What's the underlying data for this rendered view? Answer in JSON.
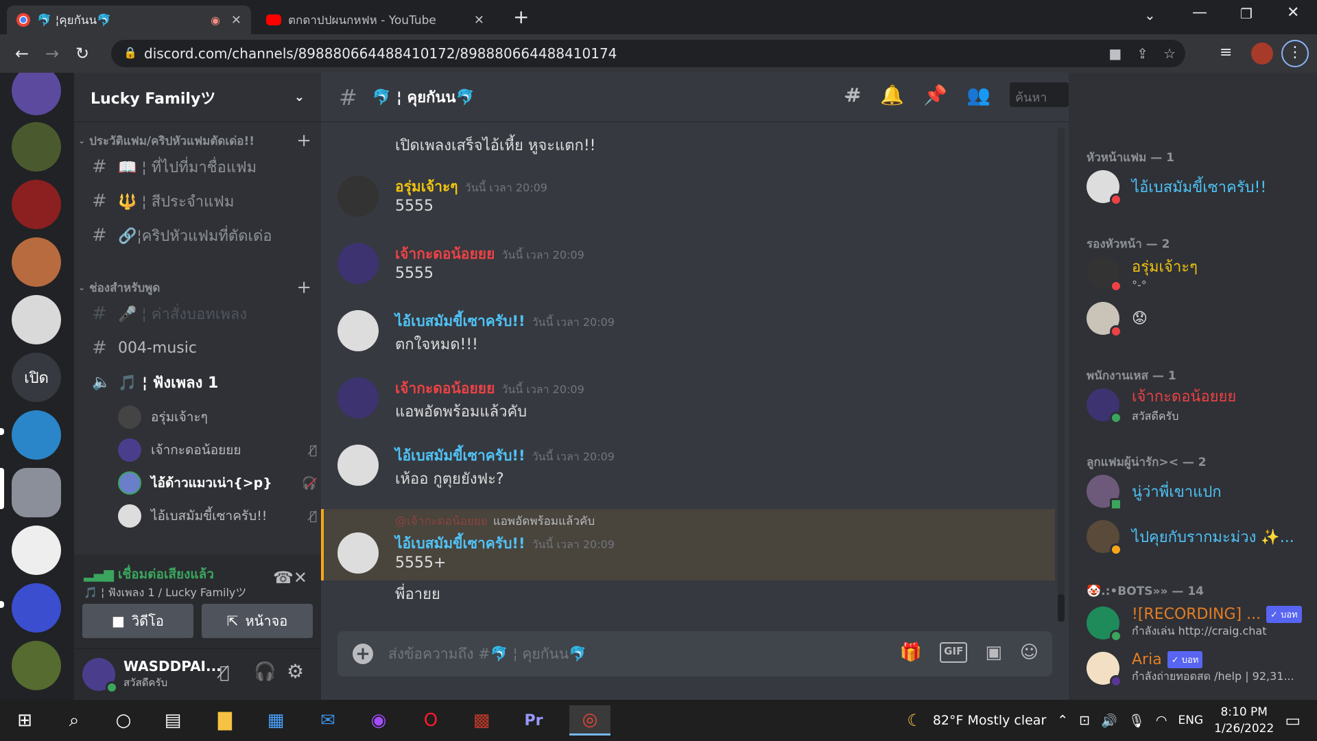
{
  "browser": {
    "tabs": [
      {
        "label": "🐬 ¦คุยกันน🐬",
        "active": true
      },
      {
        "label": "ตกดาปปผนกหฟห - YouTube",
        "active": false
      }
    ],
    "new_tab": "+",
    "url": "discord.com/channels/898880664488410172/898880664488410174"
  },
  "guild": {
    "name": "Lucky Familyツ",
    "open_label": "เปิด",
    "categories": [
      {
        "name": "ประวัติแฟม/คริปหัวแฟมตัดเด่อ!!",
        "channels": [
          "📖 ¦ ที่ไปที่มาชื่อแฟม",
          "🔱 ¦ สีประจำแฟม",
          "🔗¦คริปหัวแฟมที่ตัดเด่อ"
        ]
      },
      {
        "name": "ช่องสำหรับพูด",
        "channels": [
          "🎤 ¦ ค่าสั่งบอทเพลง",
          "004-music",
          "🎵 ¦ ฟังเพลง 1"
        ]
      }
    ],
    "voice_users": [
      "อรุ่มเจ้าะๆ",
      "เจ้ากะดอน้อยยย",
      "ไอ้ด้าวแมวเน่า{>p}",
      "ไอ้เบสมัมขี้เซาครับ!!"
    ]
  },
  "voice_panel": {
    "status": "เชื่อมต่อเสียงแล้ว",
    "channel": "🎵 ¦ ฟังเพลง 1 / Lucky Familyツ",
    "video_label": "วิดีโอ",
    "screen_label": "หน้าจอ"
  },
  "user_panel": {
    "name": "WASDDPAI...",
    "status": "สวัสดีครับ"
  },
  "channel": {
    "name": "🐬 ¦ คุยกันน🐬",
    "search_placeholder": "ค้นหา"
  },
  "messages": [
    {
      "author": "",
      "time": "",
      "text": "เปิดเพลงเสร็จไอ้เหี้ย หูจะแตก!!"
    },
    {
      "author": "อรุ่มเจ้าะๆ",
      "time": "วันนี้ เวลา 20:09",
      "text": "5555"
    },
    {
      "author": "เจ้ากะดอน้อยยย",
      "time": "วันนี้ เวลา 20:09",
      "text": "5555"
    },
    {
      "author": "ไอ้เบสมัมขี้เซาครับ!!",
      "time": "วันนี้ เวลา 20:09",
      "text": "ตกใจหมด!!!"
    },
    {
      "author": "เจ้ากะดอน้อยยย",
      "time": "วันนี้ เวลา 20:09",
      "text": "แอพอัดพร้อมแล้วคับ"
    },
    {
      "author": "ไอ้เบสมัมขี้เซาครับ!!",
      "time": "วันนี้ เวลา 20:09",
      "text": "เห้ออ กูตุยยังฟะ?"
    },
    {
      "reply_author": "@เจ้ากะดอน้อยยย",
      "reply_text": "แอพอัดพร้อมแล้วคับ",
      "author": "ไอ้เบสมัมขี้เซาครับ!!",
      "time": "วันนี้ เวลา 20:09",
      "text": "5555+",
      "text2": "พี่อายย"
    }
  ],
  "composer": {
    "placeholder": "ส่งข้อความถึง #🐬 ¦ คุยกันน🐬",
    "gif": "GIF"
  },
  "members": {
    "groups": [
      {
        "title": "หัวหน้าแฟม — 1",
        "members": [
          {
            "name": "ไอ้เบสมัมขี้เซาครับ!!",
            "sub": ""
          }
        ]
      },
      {
        "title": "รองหัวหน้า — 2",
        "members": [
          {
            "name": "อรุ่มเจ้าะๆ",
            "sub": "°-°"
          },
          {
            "name": "😟",
            "sub": ""
          }
        ]
      },
      {
        "title": "พนักงานเหส — 1",
        "members": [
          {
            "name": "เจ้ากะดอน้อยยย",
            "sub": "สวัสดีครับ"
          }
        ]
      },
      {
        "title": "ลูกแฟมผู้น่ารัก>< — 2",
        "members": [
          {
            "name": "นู่ว่าพี่เขาแปก",
            "sub": ""
          },
          {
            "name": "ไปคุยกับรากมะม่วง ✨...",
            "sub": ""
          }
        ]
      },
      {
        "title": "🤡.:•BOTS»» — 14",
        "members": [
          {
            "name": "![RECORDING] ...",
            "sub": "กำลังเล่น http://craig.chat",
            "badge": "✓ บอท"
          },
          {
            "name": "Aria",
            "sub": "กำลังถ่ายทอดสด /help | 92,31...",
            "badge": "✓ บอท"
          }
        ]
      }
    ]
  },
  "taskbar": {
    "weather": "82°F  Mostly clear",
    "lang": "ENG",
    "time": "8:10 PM",
    "date": "1/26/2022"
  },
  "colors": {
    "accent": "#5865f2",
    "red_name": "#ed4245",
    "blue_name": "#4fc3f7",
    "gold_name": "#f1c40f"
  }
}
